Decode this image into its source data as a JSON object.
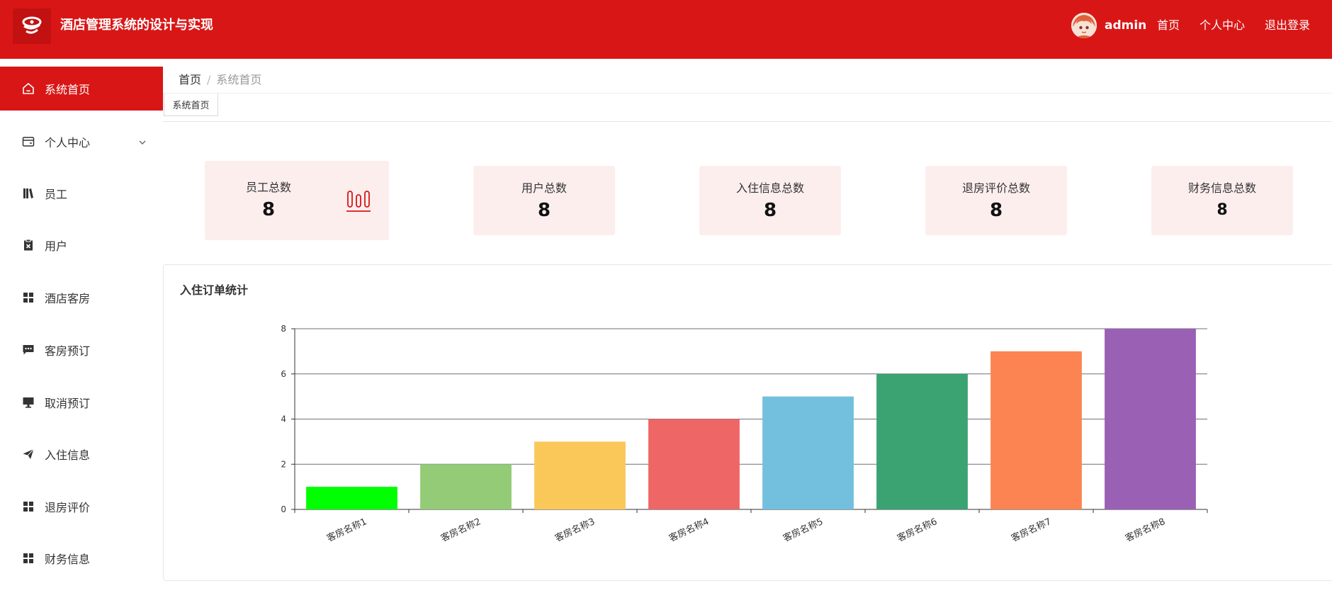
{
  "app": {
    "title": "酒店管理系统的设计与实现"
  },
  "header": {
    "user_name": "admin",
    "nav": [
      "首页",
      "个人中心",
      "退出登录"
    ]
  },
  "sidebar": {
    "items": [
      {
        "label": "系统首页",
        "icon": "home-icon",
        "active": true
      },
      {
        "label": "个人中心",
        "icon": "wallet-icon",
        "has_children": true
      },
      {
        "label": "员工",
        "icon": "books-icon"
      },
      {
        "label": "用户",
        "icon": "clipboard-x-icon"
      },
      {
        "label": "酒店客房",
        "icon": "grid-icon"
      },
      {
        "label": "客房预订",
        "icon": "chat-icon"
      },
      {
        "label": "取消预订",
        "icon": "monitor-icon"
      },
      {
        "label": "入住信息",
        "icon": "send-icon"
      },
      {
        "label": "退房评价",
        "icon": "grid-icon"
      },
      {
        "label": "财务信息",
        "icon": "grid-icon"
      }
    ]
  },
  "breadcrumb": {
    "home": "首页",
    "separator": "/",
    "current": "系统首页"
  },
  "tabs": [
    {
      "label": "系统首页"
    }
  ],
  "stats": [
    {
      "label": "员工总数",
      "value": "8"
    },
    {
      "label": "用户总数",
      "value": "8"
    },
    {
      "label": "入住信息总数",
      "value": "8"
    },
    {
      "label": "退房评价总数",
      "value": "8"
    },
    {
      "label": "财务信息总数",
      "value": "8"
    }
  ],
  "colors": {
    "primary": "#d91616",
    "card_bg": "#fdeeee"
  },
  "chart_panel": {
    "title": "入住订单统计"
  },
  "chart_data": {
    "type": "bar",
    "title": "入住订单统计",
    "categories": [
      "客房名称1",
      "客房名称2",
      "客房名称3",
      "客房名称4",
      "客房名称5",
      "客房名称6",
      "客房名称7",
      "客房名称8"
    ],
    "values": [
      1,
      2,
      3,
      4,
      5,
      6,
      7,
      8
    ],
    "colors": [
      "#00ff00",
      "#93cb77",
      "#fac858",
      "#ee6666",
      "#73c0de",
      "#3ba272",
      "#fc8452",
      "#9a60b4"
    ],
    "yticks": [
      0,
      2,
      4,
      6,
      8
    ],
    "ylim": [
      0,
      8
    ],
    "grid": true
  }
}
